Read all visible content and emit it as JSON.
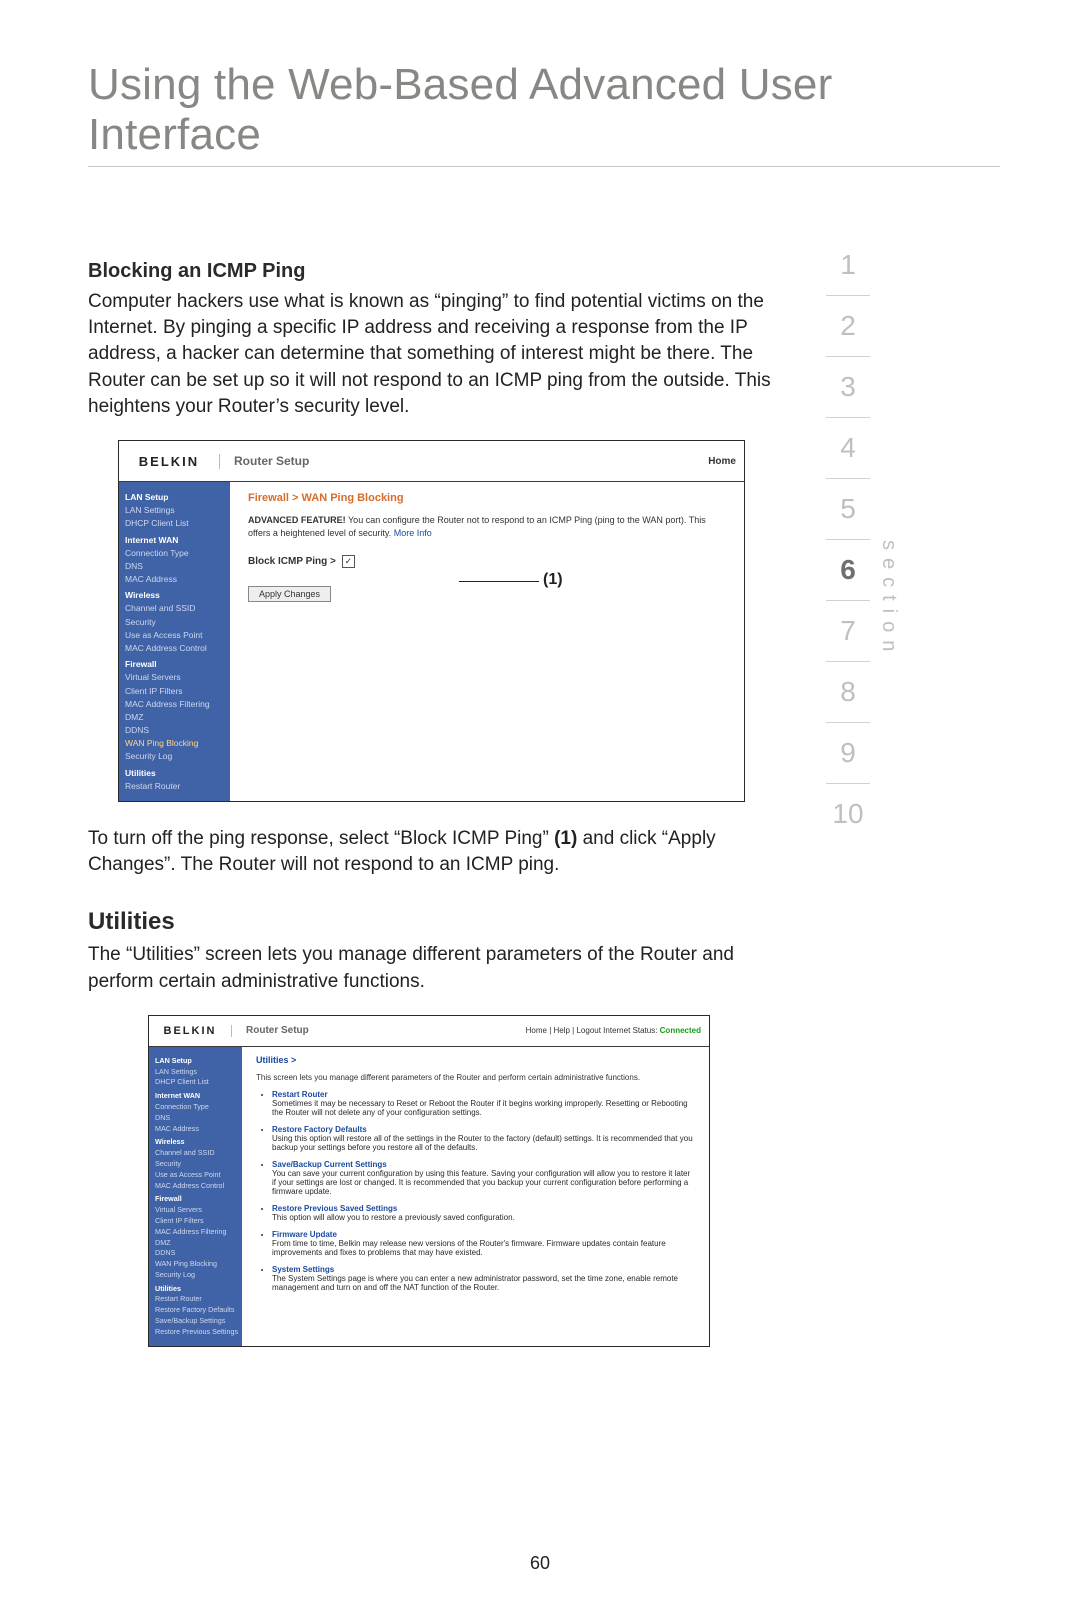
{
  "page": {
    "title": "Using the Web-Based Advanced User Interface",
    "number": "60",
    "section_label": "section"
  },
  "nav": {
    "items": [
      "1",
      "2",
      "3",
      "4",
      "5",
      "6",
      "7",
      "8",
      "9",
      "10"
    ],
    "active_index": 5
  },
  "block1": {
    "heading": "Blocking an ICMP Ping",
    "paragraph": "Computer hackers use what is known as “pinging” to find potential victims on the Internet. By pinging a specific IP address and receiving a response from the IP address, a hacker can determine that something of interest might be there. The Router can be set up so it will not respond to an ICMP ping from the outside. This heightens your Router’s security level.",
    "after_pre": "To turn off the ping response, select “Block ICMP Ping” ",
    "after_bold": "(1)",
    "after_post": " and click “Apply Changes”. The Router will not respond to an ICMP ping."
  },
  "router1": {
    "brand": "BELKIN",
    "title": "Router Setup",
    "home": "Home",
    "crumb": "Firewall > WAN Ping Blocking",
    "feature_bold": "ADVANCED FEATURE!",
    "feature_text": " You can configure the Router not to respond to an ICMP Ping (ping to the WAN port). This offers a heightened level of security. ",
    "feature_link": "More Info",
    "checkbox_label": "Block ICMP Ping >",
    "checkbox_checked": "✓",
    "apply_btn": "Apply Changes",
    "annotation": "(1)",
    "sidebar": [
      {
        "t": "hdr",
        "v": "LAN Setup"
      },
      {
        "t": "item",
        "v": "LAN Settings"
      },
      {
        "t": "item",
        "v": "DHCP Client List"
      },
      {
        "t": "hdr",
        "v": "Internet WAN"
      },
      {
        "t": "item",
        "v": "Connection Type"
      },
      {
        "t": "item",
        "v": "DNS"
      },
      {
        "t": "item",
        "v": "MAC Address"
      },
      {
        "t": "hdr",
        "v": "Wireless"
      },
      {
        "t": "item",
        "v": "Channel and SSID"
      },
      {
        "t": "item",
        "v": "Security"
      },
      {
        "t": "item",
        "v": "Use as Access Point"
      },
      {
        "t": "item",
        "v": "MAC Address Control"
      },
      {
        "t": "hdr hl",
        "v": "Firewall"
      },
      {
        "t": "item",
        "v": "Virtual Servers"
      },
      {
        "t": "item",
        "v": "Client IP Filters"
      },
      {
        "t": "item",
        "v": "MAC Address Filtering"
      },
      {
        "t": "item",
        "v": "DMZ"
      },
      {
        "t": "item",
        "v": "DDNS"
      },
      {
        "t": "item hl",
        "v": "WAN Ping Blocking"
      },
      {
        "t": "item",
        "v": "Security Log"
      },
      {
        "t": "hdr",
        "v": "Utilities"
      },
      {
        "t": "item",
        "v": "Restart Router"
      }
    ]
  },
  "block2": {
    "heading": "Utilities",
    "paragraph": "The “Utilities” screen lets you manage different parameters of the Router and perform certain administrative functions."
  },
  "router2": {
    "brand": "BELKIN",
    "title": "Router Setup",
    "home_links": "Home | Help | Logout   Internet Status: ",
    "home_status": "Connected",
    "crumb": "Utilities >",
    "intro": "This screen lets you manage different parameters of the Router and perform certain administrative functions.",
    "items": [
      {
        "t": "Restart Router",
        "d": "Sometimes it may be necessary to Reset or Reboot the Router if it begins working improperly. Resetting or Rebooting the Router will not delete any of your configuration settings."
      },
      {
        "t": "Restore Factory Defaults",
        "d": "Using this option will restore all of the settings in the Router to the factory (default) settings. It is recommended that you backup your settings before you restore all of the defaults."
      },
      {
        "t": "Save/Backup Current Settings",
        "d": "You can save your current configuration by using this feature. Saving your configuration will allow you to restore it later if your settings are lost or changed. It is recommended that you backup your current configuration before performing a firmware update."
      },
      {
        "t": "Restore Previous Saved Settings",
        "d": "This option will allow you to restore a previously saved configuration."
      },
      {
        "t": "Firmware Update",
        "d": "From time to time, Belkin may release new versions of the Router's firmware. Firmware updates contain feature improvements and fixes to problems that may have existed."
      },
      {
        "t": "System Settings",
        "d": "The System Settings page is where you can enter a new administrator password, set the time zone, enable remote management and turn on and off the NAT function of the Router."
      }
    ],
    "sidebar": [
      {
        "t": "hdr",
        "v": "LAN Setup"
      },
      {
        "t": "item",
        "v": "LAN Settings"
      },
      {
        "t": "item",
        "v": "DHCP Client List"
      },
      {
        "t": "hdr",
        "v": "Internet WAN"
      },
      {
        "t": "item",
        "v": "Connection Type"
      },
      {
        "t": "item",
        "v": "DNS"
      },
      {
        "t": "item",
        "v": "MAC Address"
      },
      {
        "t": "hdr",
        "v": "Wireless"
      },
      {
        "t": "item",
        "v": "Channel and SSID"
      },
      {
        "t": "item",
        "v": "Security"
      },
      {
        "t": "item",
        "v": "Use as Access Point"
      },
      {
        "t": "item",
        "v": "MAC Address Control"
      },
      {
        "t": "hdr",
        "v": "Firewall"
      },
      {
        "t": "item",
        "v": "Virtual Servers"
      },
      {
        "t": "item",
        "v": "Client IP Filters"
      },
      {
        "t": "item",
        "v": "MAC Address Filtering"
      },
      {
        "t": "item",
        "v": "DMZ"
      },
      {
        "t": "item",
        "v": "DDNS"
      },
      {
        "t": "item",
        "v": "WAN Ping Blocking"
      },
      {
        "t": "item",
        "v": "Security Log"
      },
      {
        "t": "hdr hl",
        "v": "Utilities"
      },
      {
        "t": "item",
        "v": "Restart Router"
      },
      {
        "t": "item",
        "v": "Restore Factory Defaults"
      },
      {
        "t": "item",
        "v": "Save/Backup Settings"
      },
      {
        "t": "item",
        "v": "Restore Previous Settings"
      }
    ]
  }
}
